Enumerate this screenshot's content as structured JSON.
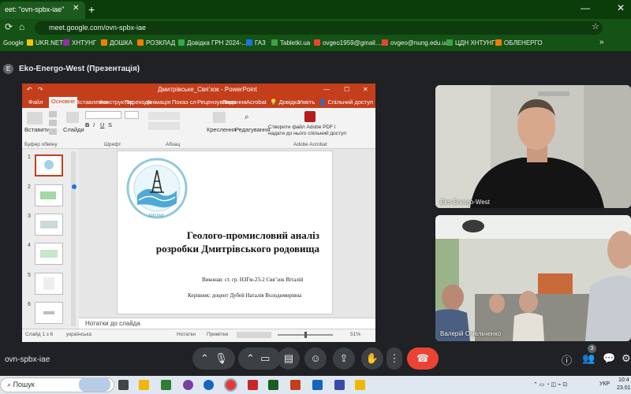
{
  "browser": {
    "tab_title": "eet: \"ovn-spbx-iae\"",
    "url": "meet.google.com/ovn-spbx-iae",
    "bookmarks": [
      "Google",
      "UKR.NET",
      "ХНТУНГ",
      "ДОШКА",
      "РОЗКЛАД",
      "Довідка ГРН 2024-...",
      "ГАЗ",
      "Tabletki.ua",
      "ovgeo1959@gmail....",
      "ovgeo@nung.edu.ua",
      "ЦДН ХНТУНГ",
      "ОБЛЕНЕРГО"
    ]
  },
  "meet": {
    "presenter_initial": "E",
    "presenter_title": "Eko-Energo-West (Презентація)",
    "meeting_code": "ovn-spbx-iae",
    "participant_count": "3"
  },
  "powerpoint": {
    "title_bar": "Дмитрівське_Свяʼзок  -  PowerPoint",
    "tabs": [
      "Файл",
      "Основне",
      "Вставлення",
      "Конструктор",
      "Переходи",
      "Анімація",
      "Показ сл",
      "Рецензування",
      "Подання",
      "Acrobat",
      "Довідка",
      "Уявіть",
      "Спільний доступ"
    ],
    "ribbon": {
      "paste": "Вставити",
      "slides": "Слайди",
      "shapes": "Креслення",
      "editing": "Редагування",
      "acrobat_btn_line1": "Створити файл Adobe PDF і",
      "acrobat_btn_line2": "надати до нього спільний доступ",
      "group_clipboard": "Буфер обміну",
      "group_font": "Шрифт",
      "group_paragraph": "Абзац",
      "group_acrobat": "Adobe Acrobat"
    },
    "thumbnails": [
      "1",
      "2",
      "3",
      "4",
      "5",
      "6"
    ],
    "slide": {
      "logo_caption": "ХНТУНГ",
      "heading_line1": "Геолого-промисловий аналіз",
      "heading_line2": "розробки Дмитрівського  родовища",
      "author": "Виконав: ст. гр. НЗГм-23-2 Свяʼзок Віталій",
      "supervisor": "Керівник: доцент Дубей Наталія Володимирівна"
    },
    "notes": "Нотатки до слайда",
    "status_slide": "Слайд 1 з 6",
    "status_lang": "українська",
    "status_notes": "Нотатки",
    "status_comments": "Примітки",
    "zoom": "51%"
  },
  "participants": [
    {
      "name": "Eko-Energo-West"
    },
    {
      "name": "Валерій Омельченко"
    }
  ],
  "taskbar": {
    "search": "Пошук",
    "lang": "УКР",
    "time": "10:4",
    "date": "23.01"
  }
}
